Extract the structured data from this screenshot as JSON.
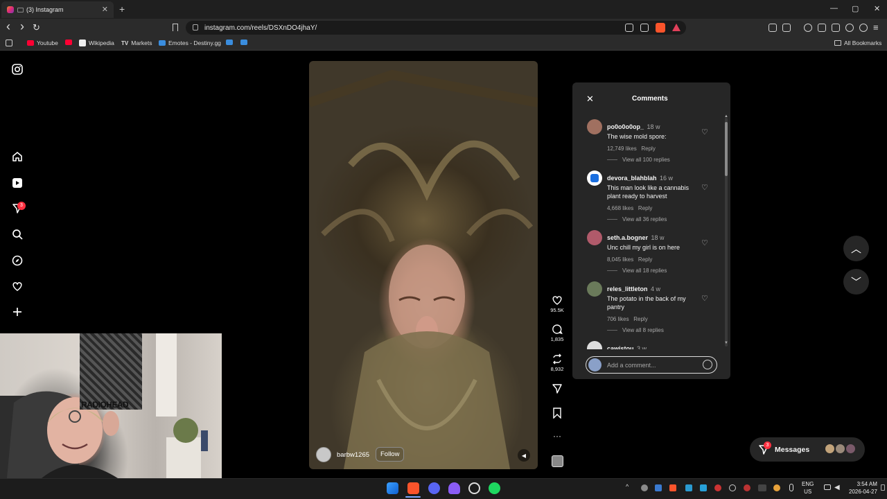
{
  "browser": {
    "tab_title": "(3) Instagram",
    "tab_close": "✕",
    "new_tab": "+",
    "url": "instagram.com/reels/DSXnDO4jhaY/",
    "window_controls": {
      "minimize": "—",
      "maximize": "▢",
      "close": "✕"
    },
    "nav": {
      "back": "‹",
      "forward": "›",
      "reload": "↻"
    }
  },
  "bookmarks": {
    "items": [
      {
        "label": "Youtube",
        "color": "#ff0033"
      },
      {
        "label": "",
        "color": "#ff0033"
      },
      {
        "label": "Wikipedia",
        "color": "#eeeeee"
      },
      {
        "label": "Markets",
        "color": "#eeeeee"
      },
      {
        "label": "Emotes - Destiny.gg",
        "color": "#3a8dde"
      },
      {
        "label": "",
        "color": "#3a8dde"
      },
      {
        "label": "",
        "color": "#3a8dde"
      }
    ],
    "all_bookmarks": "All Bookmarks"
  },
  "sidebar": {
    "notification_badge": "3",
    "icons": [
      "instagram-logo-icon",
      "home-icon",
      "reels-icon",
      "direct-icon",
      "search-icon",
      "explore-icon",
      "heart-icon",
      "create-icon"
    ]
  },
  "reel": {
    "username": "barbw1265",
    "follow_label": "Follow",
    "likes": "95.5K",
    "comments": "1,835",
    "reposts": "8,932",
    "more": "···"
  },
  "comments_panel": {
    "title": "Comments",
    "close": "✕",
    "add_placeholder": "Add a comment...",
    "items": [
      {
        "user": "po0o0o0op_",
        "time": "18 w",
        "text": [
          "The wise mold spore:"
        ],
        "likes": "12,749 likes",
        "reply": "Reply",
        "replies": "View all 100 replies",
        "avatar_color": "#a07060"
      },
      {
        "user": "devora_blahblah",
        "time": "16 w",
        "text": [
          "This man look like a cannabis",
          "plant ready to harvest"
        ],
        "likes": "4,668 likes",
        "reply": "Reply",
        "replies": "View all 36 replies",
        "avatar_color": "#1a6fe0"
      },
      {
        "user": "seth.a.bogner",
        "time": "18 w",
        "text": [
          "Unc chill my girl is on here"
        ],
        "likes": "8,045 likes",
        "reply": "Reply",
        "replies": "View all 18 replies",
        "avatar_color": "#b05a6a"
      },
      {
        "user": "reles_littleton",
        "time": "4 w",
        "text": [
          "The potato in the back of my",
          "pantry"
        ],
        "likes": "706 likes",
        "reply": "Reply",
        "replies": "View all 8 replies",
        "avatar_color": "#6a7a5a"
      },
      {
        "user": "cawistou",
        "time": "3 w",
        "text": [],
        "likes": "",
        "reply": "",
        "replies": "",
        "avatar_color": "#dddddd"
      }
    ]
  },
  "messages": {
    "label": "Messages",
    "badge": "3"
  },
  "webcam": {
    "poster_text": "RADIOHEAD"
  },
  "taskbar": {
    "lang_top": "ENG",
    "lang_bottom": "US",
    "time": "3:54 AM",
    "date": "2026-04-27",
    "tray_up": "^"
  }
}
